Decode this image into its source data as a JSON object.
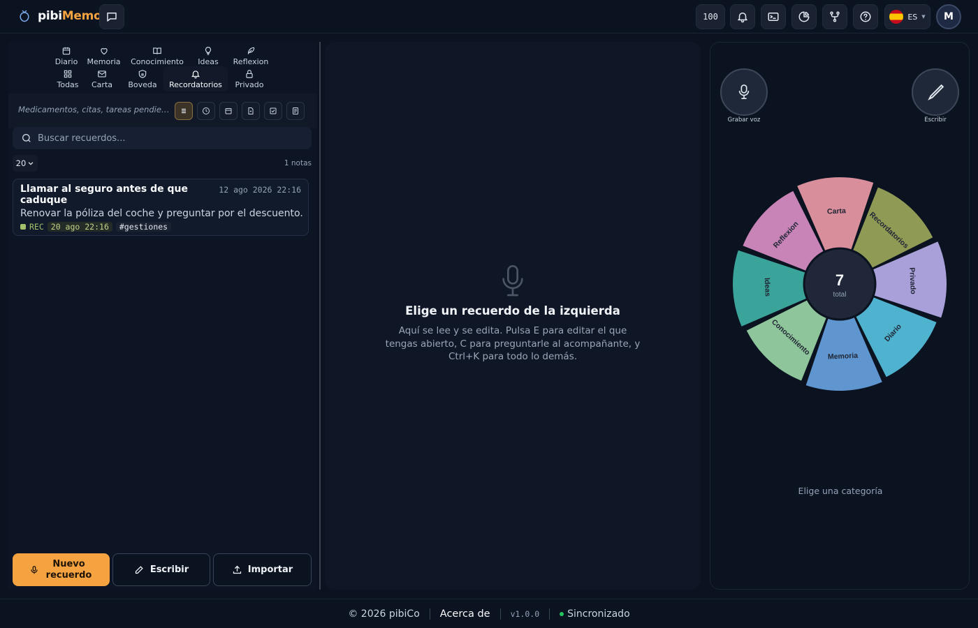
{
  "app": {
    "name_part1": "pibi",
    "name_part2": "Memo"
  },
  "header": {
    "counter": "100",
    "language": "ES",
    "avatar_initial": "M"
  },
  "categories_row1": [
    {
      "label": "Diario",
      "icon": "calendar-icon"
    },
    {
      "label": "Memoria",
      "icon": "heart-icon"
    },
    {
      "label": "Conocimiento",
      "icon": "book-icon"
    },
    {
      "label": "Ideas",
      "icon": "lightbulb-icon"
    },
    {
      "label": "Reflexion",
      "icon": "feather-icon"
    }
  ],
  "categories_row2": [
    {
      "label": "Todas",
      "icon": "grid-icon"
    },
    {
      "label": "Carta",
      "icon": "envelope-icon"
    },
    {
      "label": "Boveda",
      "icon": "shield-icon"
    },
    {
      "label": "Recordatorios",
      "icon": "bell-icon",
      "active": true
    },
    {
      "label": "Privado",
      "icon": "lock-icon"
    }
  ],
  "subbar": {
    "hint": "Medicamentos, citas, tareas pendientes..."
  },
  "search": {
    "placeholder": "Buscar recuerdos..."
  },
  "list": {
    "page_size": "20",
    "count_label": "1 notas",
    "notes": [
      {
        "title": "Llamar al seguro antes de que caduque",
        "date": "12 ago 2026 22:16",
        "body": "Renovar la póliza del coche y preguntar por el descuento.",
        "rec_label": "REC",
        "rec_date": "20 ago 22:16",
        "tag": "#gestiones"
      }
    ]
  },
  "actions": {
    "new_label": "Nuevo recuerdo",
    "write_label": "Escribir",
    "import_label": "Importar"
  },
  "empty_state": {
    "title": "Elige un recuerdo de la izquierda",
    "text": "Aquí se lee y se edita. Pulsa E para editar el que tengas abierto, C para preguntarle al acompañante, y Ctrl+K para todo lo demás."
  },
  "right_panel": {
    "record_label": "Grabar voz",
    "write_label": "Escribir",
    "wheel_total": "7",
    "wheel_total_label": "total",
    "wheel_segments": [
      {
        "label": "Carta",
        "color": "#d98e9b"
      },
      {
        "label": "Recordatorios",
        "color": "#8f9a55"
      },
      {
        "label": "Privado",
        "color": "#a9a0d9"
      },
      {
        "label": "Diario",
        "color": "#4fb3cf"
      },
      {
        "label": "Memoria",
        "color": "#5f96d0"
      },
      {
        "label": "Conocimiento",
        "color": "#8ec59a"
      },
      {
        "label": "Ideas",
        "color": "#3aa39a"
      },
      {
        "label": "Reflexion",
        "color": "#c884b6"
      }
    ],
    "hint": "Elige una categoría"
  },
  "footer": {
    "copyright": "© 2026 pibiCo",
    "about": "Acerca de",
    "version": "v1.0.0",
    "sync": "Sincronizado"
  }
}
